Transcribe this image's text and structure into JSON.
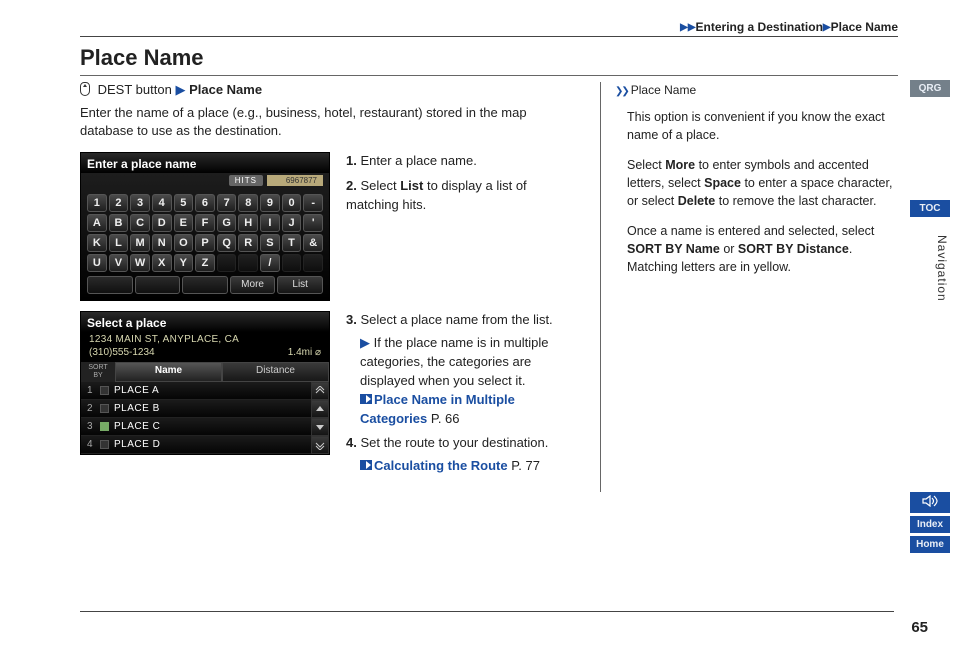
{
  "breadcrumb": {
    "a": "Entering a Destination",
    "b": "Place Name"
  },
  "heading": "Place Name",
  "intro": {
    "dest": "DEST button",
    "place": "Place Name",
    "desc": "Enter the name of a place (e.g., business, hotel, restaurant) stored in the map database to use as the destination."
  },
  "screen1": {
    "title": "Enter a place name",
    "hits_label": "HITS",
    "hits_value": "6967877",
    "keys_r1": [
      "1",
      "2",
      "3",
      "4",
      "5",
      "6",
      "7",
      "8",
      "9",
      "0",
      "-"
    ],
    "keys_r2": [
      "A",
      "B",
      "C",
      "D",
      "E",
      "F",
      "G",
      "H",
      "I",
      "J",
      "'"
    ],
    "keys_r3": [
      "K",
      "L",
      "M",
      "N",
      "O",
      "P",
      "Q",
      "R",
      "S",
      "T",
      "&"
    ],
    "keys_r4": [
      "U",
      "V",
      "W",
      "X",
      "Y",
      "Z",
      "",
      "",
      "/",
      "",
      ""
    ],
    "more": "More",
    "list": "List"
  },
  "steps12": {
    "s1": "Enter a place name.",
    "s2a": "Select ",
    "s2b": "List",
    "s2c": " to display a list of matching hits."
  },
  "screen2": {
    "title": "Select a place",
    "address": "1234 MAIN ST, ANYPLACE, CA",
    "phone": "(310)555-1234",
    "dist": "1.4mi",
    "sort": "SORT BY",
    "tab_name": "Name",
    "tab_dist": "Distance",
    "rows": [
      "PLACE A",
      "PLACE B",
      "PLACE C",
      "PLACE D"
    ]
  },
  "steps34": {
    "s3": "Select a place name from the list.",
    "s3sub": "If the place name is in multiple categories, the categories are displayed when you select it.",
    "xref1": "Place Name in Multiple Categories",
    "xref1p": "P. 66",
    "s4": "Set the route to your destination.",
    "xref2": "Calculating the Route",
    "xref2p": "P. 77"
  },
  "sidebar": {
    "title": "Place Name",
    "p1": "This option is convenient if you know the exact name of a place.",
    "p2a": "Select ",
    "p2b": "More",
    "p2c": " to enter symbols and accented letters, select ",
    "p2d": "Space",
    "p2e": " to enter a space character, or select ",
    "p2f": "Delete",
    "p2g": " to remove the last character.",
    "p3a": "Once a name is entered and selected, select ",
    "p3b": "SORT BY Name",
    "p3c": " or ",
    "p3d": "SORT BY Distance",
    "p3e": ". Matching letters are in yellow."
  },
  "edge": {
    "qrg": "QRG",
    "toc": "TOC",
    "voice": "ᵛ🔊",
    "index": "Index",
    "home": "Home",
    "section": "Navigation"
  },
  "colors": {
    "qrg": "#74808a",
    "toc": "#1a4ea1",
    "voice": "#1a4ea1",
    "index": "#1a4ea1",
    "home": "#1a4ea1"
  },
  "page_number": "65"
}
